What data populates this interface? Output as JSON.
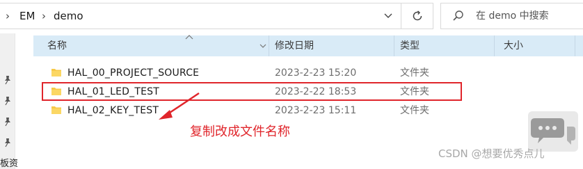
{
  "address_bar": {
    "breadcrumbs": [
      "EM",
      "demo"
    ]
  },
  "search": {
    "placeholder": "在 demo 中搜索"
  },
  "columns": {
    "name": "名称",
    "modified": "修改日期",
    "type": "类型",
    "size": "大小"
  },
  "rows": [
    {
      "name": "HAL_00_PROJECT_SOURCE",
      "modified": "2023-2-23 15:20",
      "type": "文件夹"
    },
    {
      "name": "HAL_01_LED_TEST",
      "modified": "2023-2-22 18:53",
      "type": "文件夹"
    },
    {
      "name": "HAL_02_KEY_TEST",
      "modified": "2023-2-23 15:11",
      "type": "文件夹"
    }
  ],
  "annotation": {
    "text": "复制改成文件名称",
    "color": "#e0252b"
  },
  "nav": {
    "fragment": "板资"
  },
  "watermark": {
    "text": "CSDN @想要优秀点儿"
  },
  "colors": {
    "header_bg": "#d9ebf7",
    "folder": "#f7c948",
    "annotation_red": "#e0252b"
  },
  "icons": [
    "chevron-right-icon",
    "chevron-down-icon",
    "refresh-icon",
    "search-icon",
    "pin-icon",
    "folder-icon",
    "chat-icon"
  ]
}
